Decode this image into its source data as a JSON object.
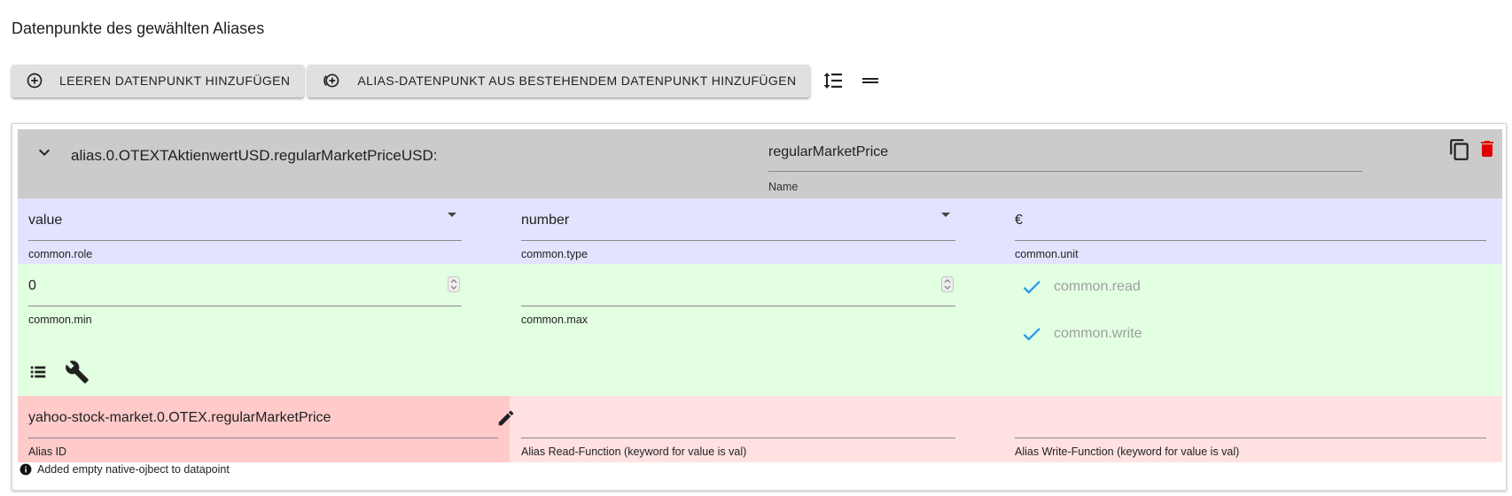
{
  "section": {
    "title": "Datenpunkte des gewählten Aliases"
  },
  "toolbar": {
    "add_empty_label": "LEEREN DATENPUNKT HINZUFÜGEN",
    "add_alias_label": "ALIAS-DATENPUNKT AUS BESTEHENDEM DATENPUNKT HINZUFÜGEN"
  },
  "datapoint": {
    "id": "alias.0.OTEXTAktienwertUSD.regularMarketPriceUSD:",
    "name": {
      "value": "regularMarketPrice",
      "label": "Name"
    },
    "role": {
      "value": "value",
      "label": "common.role"
    },
    "type": {
      "value": "number",
      "label": "common.type"
    },
    "unit": {
      "value": "€",
      "label": "common.unit"
    },
    "min": {
      "value": "0",
      "label": "common.min"
    },
    "max": {
      "value": "",
      "label": "common.max"
    },
    "read": {
      "label": "common.read",
      "checked": true
    },
    "write": {
      "label": "common.write",
      "checked": true
    },
    "alias_id": {
      "value": "yahoo-stock-market.0.OTEX.regularMarketPrice",
      "label": "Alias ID"
    },
    "read_fn": {
      "value": "",
      "label": "Alias Read-Function (keyword for value is val)"
    },
    "write_fn": {
      "value": "",
      "label": "Alias Write-Function (keyword for value is val)"
    },
    "info": "Added empty native-ojbect to datapoint"
  },
  "colors": {
    "header_bg": "#cbcbcb",
    "row_common": "#e3e3ff",
    "row_limits": "#e2ffe2",
    "row_alias": "#ffe1e1",
    "alias_id_bg": "#ffcaca",
    "check_blue": "#2196f3",
    "delete_red": "#e00000"
  }
}
